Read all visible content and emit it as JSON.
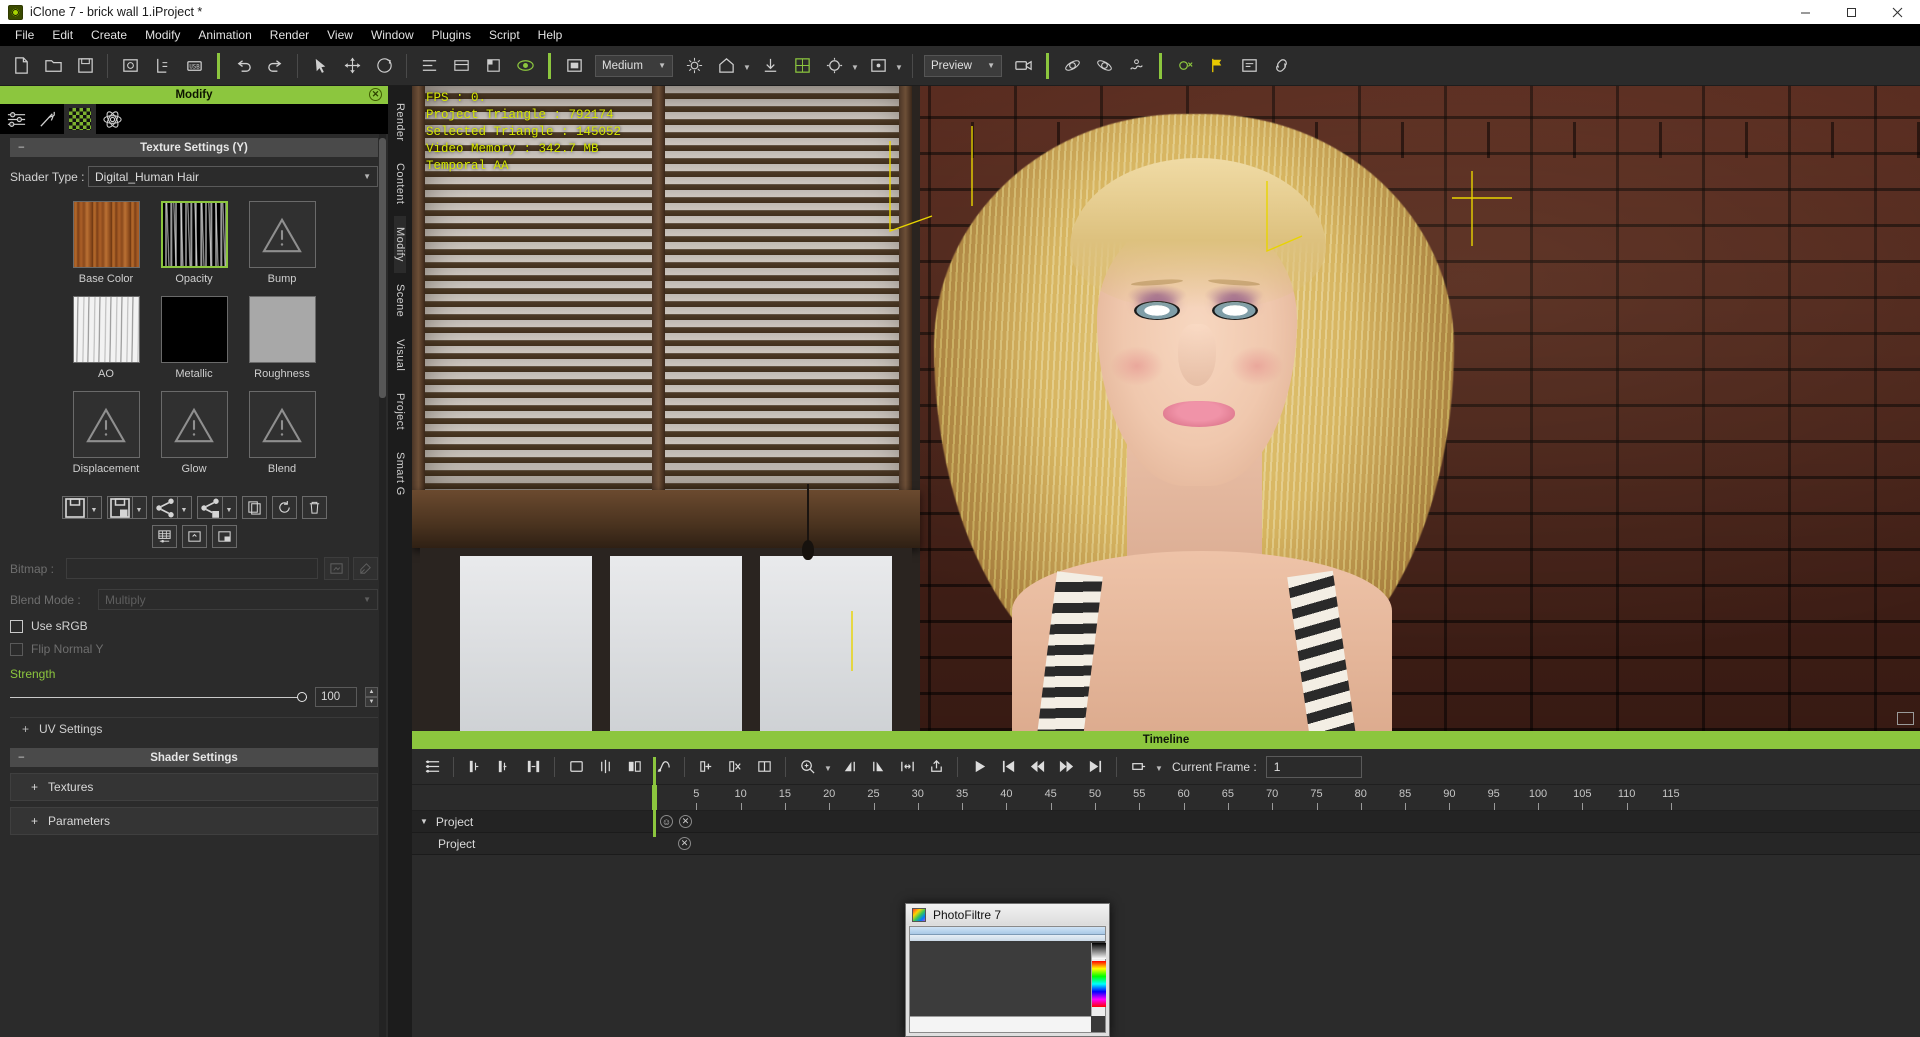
{
  "window": {
    "title": "iClone 7 - brick wall 1.iProject *",
    "app_icon": "iclone-logo-icon",
    "controls": {
      "minimize": "minimize-icon",
      "maximize": "maximize-icon",
      "close": "close-icon"
    }
  },
  "menu": {
    "items": [
      "File",
      "Edit",
      "Create",
      "Modify",
      "Animation",
      "Render",
      "View",
      "Window",
      "Plugins",
      "Script",
      "Help"
    ]
  },
  "toolbar": {
    "buttons": [
      {
        "name": "new-project-icon"
      },
      {
        "name": "open-project-icon"
      },
      {
        "name": "save-project-icon"
      },
      {
        "name": "save-image-icon"
      },
      {
        "name": "export-icon"
      },
      {
        "name": "usb-transfer-icon"
      },
      {
        "name": "undo-icon"
      },
      {
        "name": "redo-icon"
      },
      {
        "name": "select-tool-icon"
      },
      {
        "name": "move-tool-icon"
      },
      {
        "name": "rotate-tool-icon"
      },
      {
        "name": "scale-tool-icon"
      },
      {
        "name": "align-icon"
      },
      {
        "name": "layers-icon"
      },
      {
        "name": "preview-eye-icon"
      },
      {
        "name": "render-quality-icon"
      },
      {
        "name": "light-icon"
      },
      {
        "name": "home-icon"
      },
      {
        "name": "download-icon"
      },
      {
        "name": "grid-icon"
      },
      {
        "name": "camera-settings-icon"
      },
      {
        "name": "viewport-icon"
      },
      {
        "name": "camera-icon"
      },
      {
        "name": "physics-icon"
      },
      {
        "name": "softcloth-icon"
      },
      {
        "name": "spring-icon"
      },
      {
        "name": "plugin-icon"
      },
      {
        "name": "flag-icon"
      },
      {
        "name": "screenshot-icon"
      },
      {
        "name": "link-icon"
      }
    ],
    "quality_combo": {
      "value": "Medium"
    },
    "preview_combo": {
      "value": "Preview"
    }
  },
  "left_panel": {
    "title": "Modify",
    "close_icon": "panel-close-icon",
    "tabs": [
      {
        "name": "attribute-tab",
        "icon": "sliders-icon",
        "selected": false
      },
      {
        "name": "motion-tab",
        "icon": "motion-icon",
        "selected": false
      },
      {
        "name": "material-tab",
        "icon": "checker-icon",
        "selected": true
      },
      {
        "name": "physics-tab",
        "icon": "atom-icon",
        "selected": false
      }
    ],
    "texture_settings": {
      "header": "Texture Settings  (Y)",
      "toggle": "−",
      "shader_type_label": "Shader Type :",
      "shader_type_value": "Digital_Human Hair",
      "slots": [
        {
          "label": "Base Color",
          "state": "filled",
          "kind": "base",
          "selected": false
        },
        {
          "label": "Opacity",
          "state": "filled",
          "kind": "opacity",
          "selected": true
        },
        {
          "label": "Bump",
          "state": "empty",
          "kind": "warn",
          "selected": false
        },
        {
          "label": "AO",
          "state": "filled",
          "kind": "ao",
          "selected": false
        },
        {
          "label": "Metallic",
          "state": "filled",
          "kind": "black",
          "selected": false
        },
        {
          "label": "Roughness",
          "state": "filled",
          "kind": "gray",
          "selected": false
        },
        {
          "label": "Displacement",
          "state": "empty",
          "kind": "warn",
          "selected": false
        },
        {
          "label": "Glow",
          "state": "empty",
          "kind": "warn",
          "selected": false
        },
        {
          "label": "Blend",
          "state": "empty",
          "kind": "warn",
          "selected": false
        }
      ],
      "action_buttons": [
        {
          "name": "save-material-button",
          "icon": "floppy-icon",
          "has_dropdown": true
        },
        {
          "name": "save-all-material-button",
          "icon": "floppy-plus-icon",
          "has_dropdown": true
        },
        {
          "name": "share-material-button",
          "icon": "share-icon",
          "has_dropdown": true
        },
        {
          "name": "share-all-material-button",
          "icon": "share-plus-icon",
          "has_dropdown": true
        },
        {
          "name": "copy-material-button",
          "icon": "copy-icon",
          "has_dropdown": false
        },
        {
          "name": "reset-material-button",
          "icon": "reset-icon",
          "has_dropdown": false
        },
        {
          "name": "delete-material-button",
          "icon": "trash-icon",
          "has_dropdown": false
        }
      ],
      "action_buttons_row2": [
        {
          "name": "texture-grid-button",
          "icon": "texture-grid-icon"
        },
        {
          "name": "texture-replace-button",
          "icon": "replace-icon"
        },
        {
          "name": "texture-split-button",
          "icon": "split-icon"
        }
      ],
      "bitmap_label": "Bitmap :",
      "bitmap_value": "",
      "bitmap_browse_icon": "browse-icon",
      "bitmap_pick_icon": "pick-icon",
      "blend_mode_label": "Blend Mode :",
      "blend_mode_value": "Multiply",
      "use_srgb_label": "Use sRGB",
      "use_srgb_checked": false,
      "flip_normal_label": "Flip Normal Y",
      "flip_normal_checked": false,
      "strength_label": "Strength",
      "strength_value": "100"
    },
    "uv_settings": {
      "label": "UV Settings",
      "toggle": "+"
    },
    "shader_settings": {
      "header": "Shader Settings",
      "toggle": "−"
    },
    "textures_section": {
      "label": "Textures",
      "toggle": "+"
    },
    "parameters_section": {
      "label": "Parameters",
      "toggle": "+"
    }
  },
  "vertical_tabs": [
    {
      "label": "Render",
      "selected": false
    },
    {
      "label": "Content",
      "selected": false
    },
    {
      "label": "Modify",
      "selected": true
    },
    {
      "label": "Scene",
      "selected": false
    },
    {
      "label": "Visual",
      "selected": false
    },
    {
      "label": "Project",
      "selected": false
    },
    {
      "label": "Smart G",
      "selected": false
    }
  ],
  "viewport": {
    "stats": "FPS : 0.\nProject Triangle : 792174\nSelected Triangle : 145052\nVideo Memory : 342.7 MB\nTemporal AA",
    "fullscreen_icon": "expand-viewport-icon"
  },
  "timeline": {
    "title": "Timeline",
    "buttons": [
      {
        "name": "track-list-icon"
      },
      {
        "name": "add-transform-key-icon"
      },
      {
        "name": "keyframe-edit-icon"
      },
      {
        "name": "key-toggle-icon"
      },
      {
        "name": "collapse-keys-icon"
      },
      {
        "name": "expand-keys-icon"
      },
      {
        "name": "align-keys-icon"
      },
      {
        "name": "clip-icon"
      },
      {
        "name": "split-clip-icon"
      },
      {
        "name": "merge-clip-icon"
      },
      {
        "name": "curve-icon"
      },
      {
        "name": "add-clip-icon"
      },
      {
        "name": "delete-clip-icon"
      },
      {
        "name": "clip-range-icon"
      },
      {
        "name": "zoom-timeline-icon"
      },
      {
        "name": "clip-start-icon"
      },
      {
        "name": "clip-end-icon"
      },
      {
        "name": "fit-range-icon"
      },
      {
        "name": "export-clip-icon"
      },
      {
        "name": "play-icon"
      },
      {
        "name": "jump-start-icon"
      },
      {
        "name": "step-back-icon"
      },
      {
        "name": "step-forward-icon"
      },
      {
        "name": "jump-end-icon"
      },
      {
        "name": "loop-icon"
      }
    ],
    "current_frame_label": "Current Frame :",
    "current_frame_value": "1",
    "ruler_ticks": [
      5,
      10,
      15,
      20,
      25,
      30,
      35,
      40,
      45,
      50,
      55,
      60,
      65,
      70,
      75,
      80,
      85,
      90,
      95,
      100,
      105,
      110,
      115
    ],
    "tracks": [
      {
        "label": "Project",
        "level": 0,
        "caret": "▼"
      },
      {
        "label": "Project",
        "level": 1,
        "caret": ""
      }
    ]
  },
  "photofiltre": {
    "title": "PhotoFiltre 7",
    "icon": "photofiltre-icon"
  },
  "colors": {
    "accent_green": "#8cc63e",
    "panel_bg": "#2b2b2b",
    "stats_yellow": "#d7e800",
    "title_bg": "#ffffff"
  }
}
